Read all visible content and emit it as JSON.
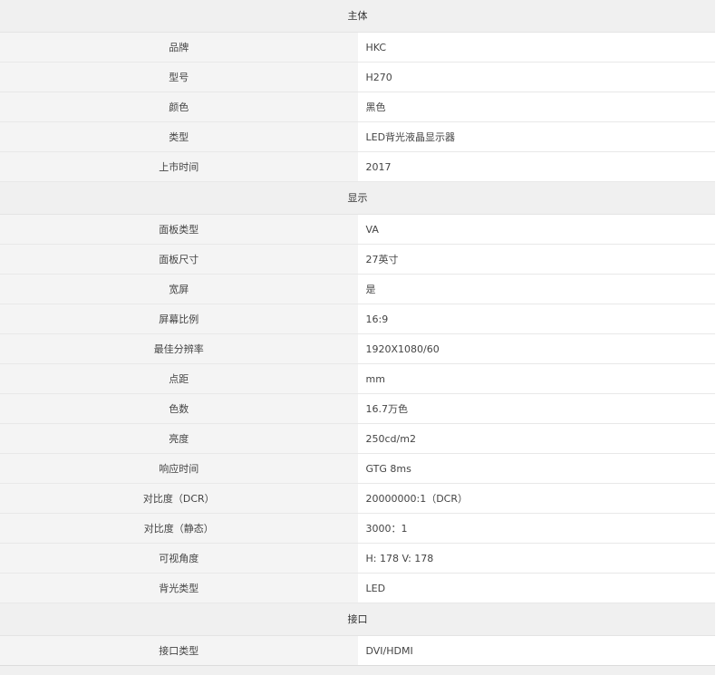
{
  "sections": [
    {
      "title": "主体",
      "rows": [
        {
          "label": "品牌",
          "value": "HKC"
        },
        {
          "label": "型号",
          "value": "H270"
        },
        {
          "label": "颜色",
          "value": "黑色"
        },
        {
          "label": "类型",
          "value": "LED背光液晶显示器"
        },
        {
          "label": "上市时间",
          "value": "2017"
        }
      ]
    },
    {
      "title": "显示",
      "rows": [
        {
          "label": "面板类型",
          "value": "VA"
        },
        {
          "label": "面板尺寸",
          "value": "27英寸"
        },
        {
          "label": "宽屏",
          "value": "是"
        },
        {
          "label": "屏幕比例",
          "value": "16:9"
        },
        {
          "label": "最佳分辨率",
          "value": "1920X1080/60"
        },
        {
          "label": "点距",
          "value": "mm"
        },
        {
          "label": "色数",
          "value": "16.7万色"
        },
        {
          "label": "亮度",
          "value": "250cd/m2"
        },
        {
          "label": "响应时间",
          "value": "GTG 8ms"
        },
        {
          "label": "对比度（DCR）",
          "value": "20000000:1（DCR）"
        },
        {
          "label": "对比度（静态）",
          "value": "3000：1"
        },
        {
          "label": "可视角度",
          "value": "H: 178 V: 178"
        },
        {
          "label": "背光类型",
          "value": "LED"
        }
      ]
    },
    {
      "title": "接口",
      "rows": [
        {
          "label": "接口类型",
          "value": "DVI/HDMI"
        }
      ]
    }
  ]
}
